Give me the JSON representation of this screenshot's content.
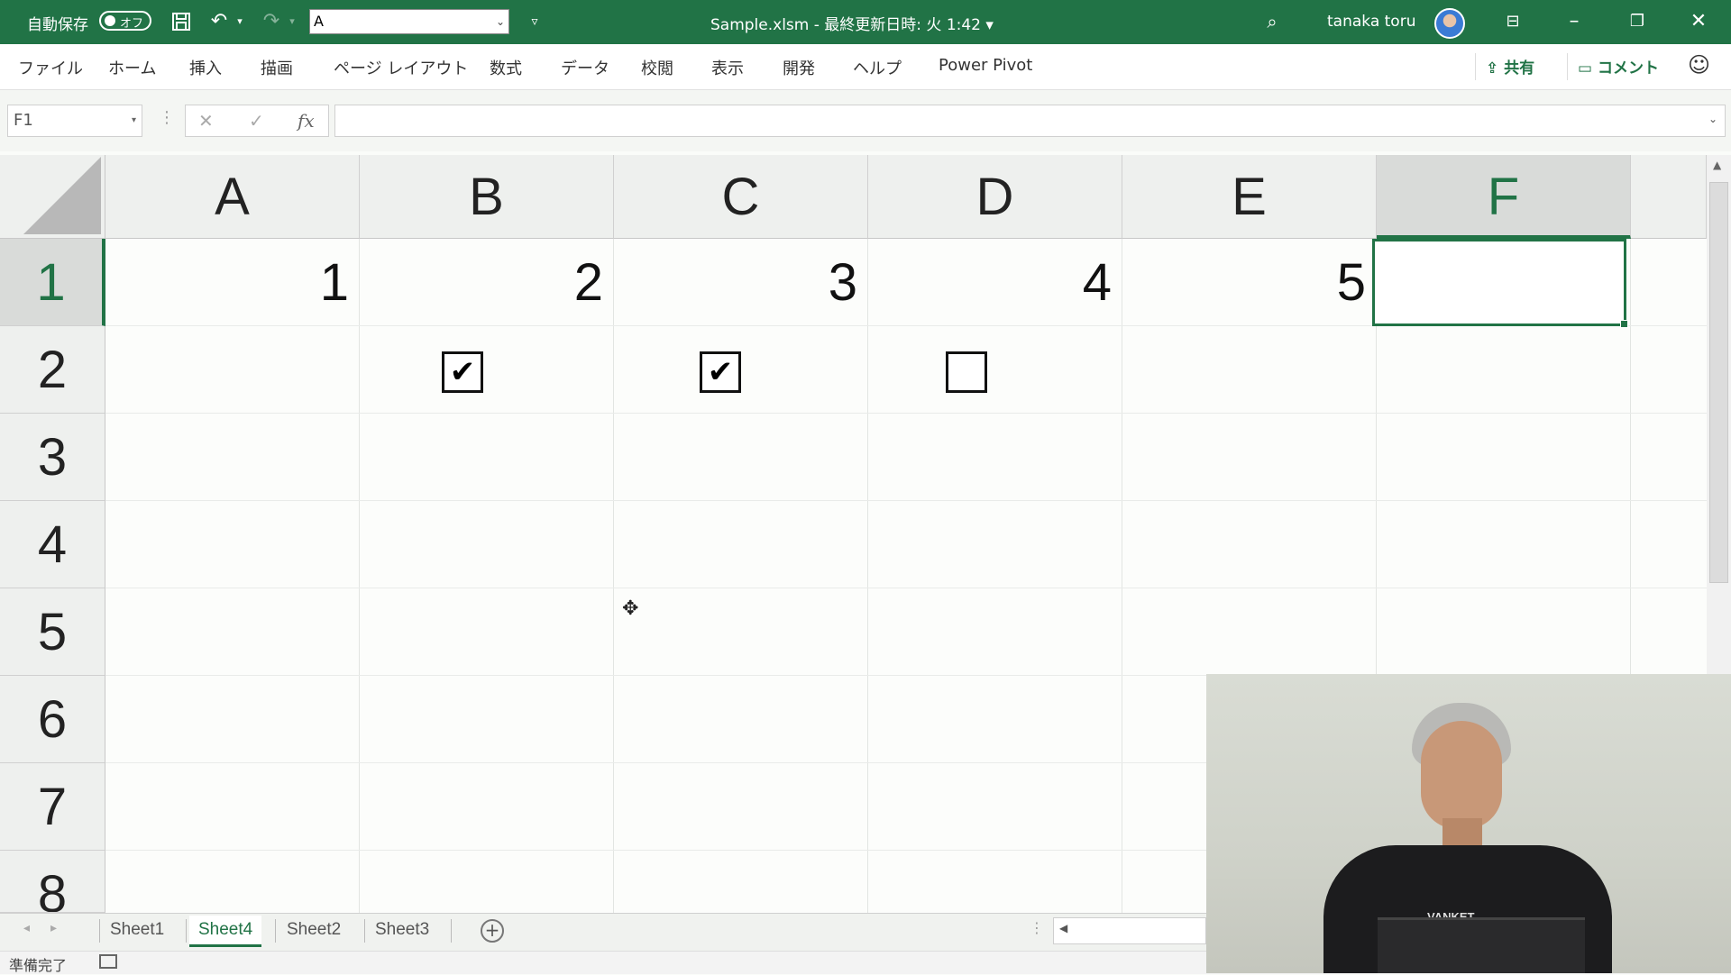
{
  "titlebar": {
    "autosave_label": "自動保存",
    "autosave_state": "オフ",
    "font_name": "A",
    "file_title": "Sample.xlsm - 最終更新日時: 火 1:42 ▾",
    "user_name": "tanaka toru"
  },
  "ribbon": {
    "tabs": [
      "ファイル",
      "ホーム",
      "挿入",
      "描画",
      "ページ レイアウト",
      "数式",
      "データ",
      "校閲",
      "表示",
      "開発",
      "ヘルプ",
      "Power Pivot"
    ],
    "share_label": "共有",
    "comment_label": "コメント"
  },
  "formula_bar": {
    "name_box": "F1",
    "cancel_glyph": "✕",
    "enter_glyph": "✓",
    "fx_glyph": "fx",
    "formula": ""
  },
  "grid": {
    "columns": [
      "A",
      "B",
      "C",
      "D",
      "E",
      "F"
    ],
    "selected_column": "F",
    "rows": [
      "1",
      "2",
      "3",
      "4",
      "5",
      "6",
      "7",
      "8"
    ],
    "selected_row": "1",
    "row1_values": [
      "1",
      "2",
      "3",
      "4",
      "5",
      ""
    ],
    "row2_checkboxes": [
      {
        "column": "B",
        "checked": true
      },
      {
        "column": "C",
        "checked": true
      },
      {
        "column": "D",
        "checked": false
      }
    ],
    "active_cell": "F1"
  },
  "sheet_tabs": {
    "tabs": [
      "Sheet1",
      "Sheet4",
      "Sheet2",
      "Sheet3"
    ],
    "active": "Sheet4"
  },
  "statusbar": {
    "status": "準備完了"
  },
  "webcam": {
    "shirt_text": "VANKET"
  },
  "colors": {
    "accent": "#217346",
    "ribbon_bg": "#ffffff",
    "grid_line": "#e2e5e2"
  }
}
